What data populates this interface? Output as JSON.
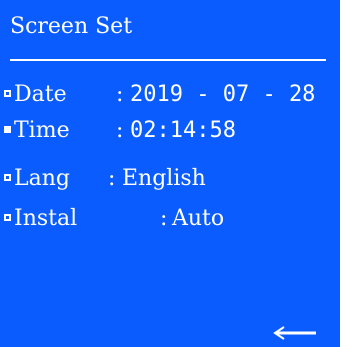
{
  "screen": {
    "title": "Screen Set",
    "background_color": "#0a5cff",
    "text_color": "#ffffff"
  },
  "menu": {
    "items": [
      {
        "label": "Date",
        "colon": ":",
        "value": "2019 - 07 - 28",
        "selected": false
      },
      {
        "label": "Time",
        "colon": ":",
        "value": "02:14:58",
        "selected": true
      },
      {
        "label": "Lang",
        "colon": ":",
        "value": "English",
        "selected": false
      },
      {
        "label": "Instal",
        "colon": ":",
        "value": "Auto",
        "selected": false
      }
    ]
  },
  "footer": {
    "back_icon": "left-arrow-icon"
  }
}
